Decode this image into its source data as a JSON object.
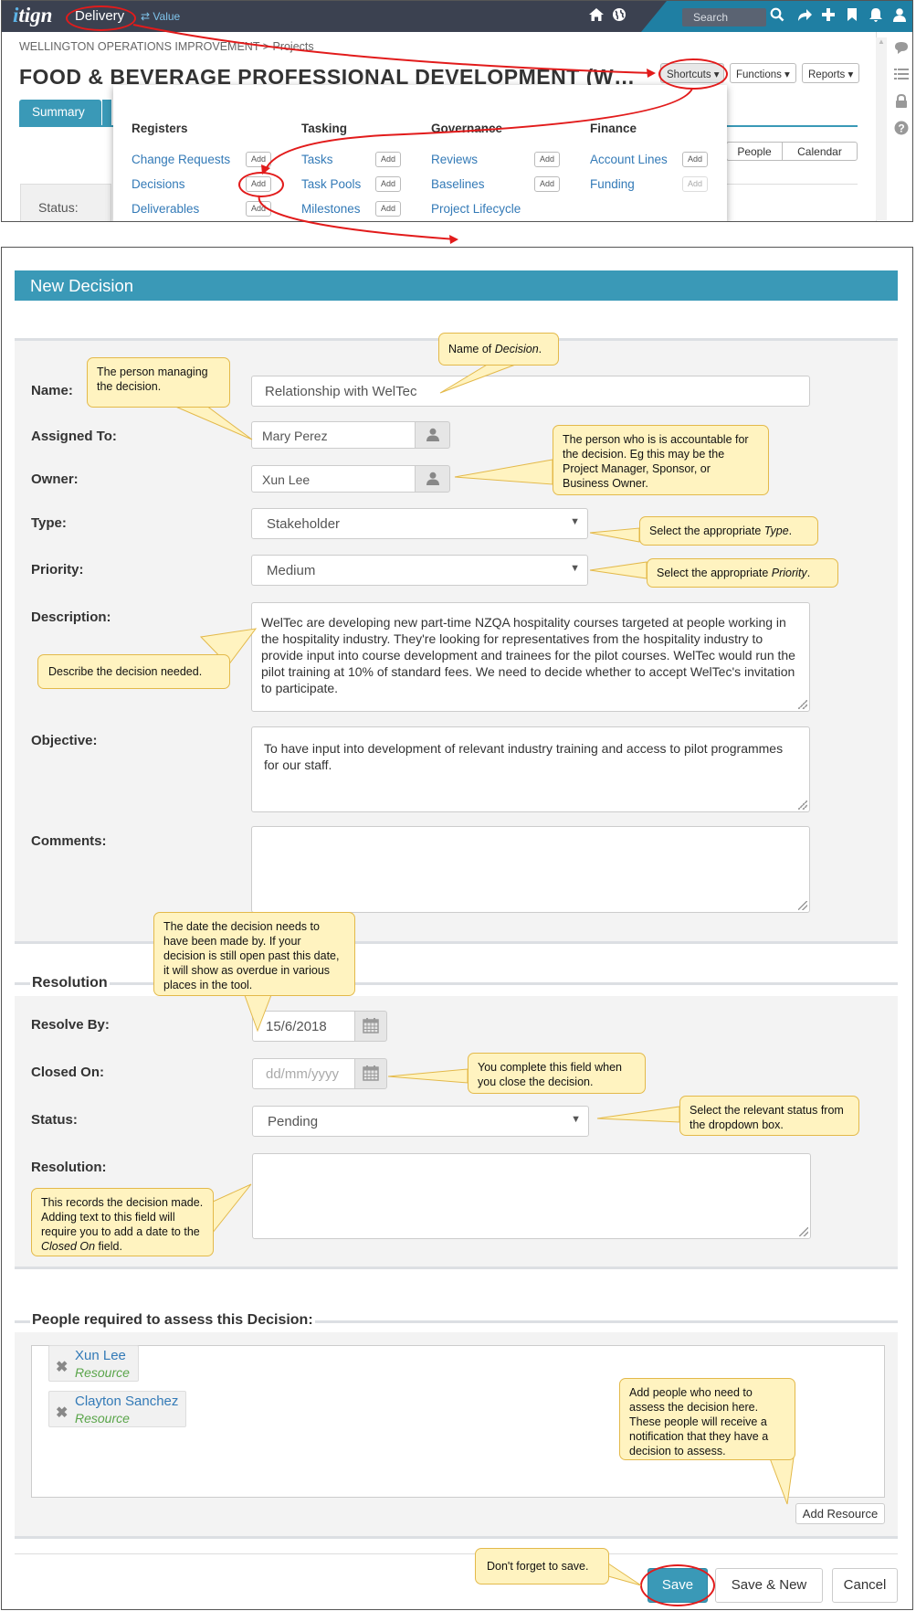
{
  "app": {
    "logo_prefix": "i",
    "logo_rest": "tign"
  },
  "nav": {
    "delivery": "Delivery",
    "value_arrow": "⇄",
    "value": "Value",
    "search_placeholder": "Search"
  },
  "breadcrumb": {
    "org": "WELLINGTON OPERATIONS IMPROVEMENT",
    "sep": " > ",
    "projects": "Projects"
  },
  "project_title": "FOOD & BEVERAGE PROFESSIONAL DEVELOPMENT (W…",
  "toolbar": {
    "shortcuts": "Shortcuts ▾",
    "functions": "Functions ▾",
    "reports": "Reports ▾"
  },
  "tabs": {
    "summary": "Summary"
  },
  "view_buttons": {
    "people": "People",
    "calendar": "Calendar"
  },
  "status_label": "Status:",
  "dropdown": {
    "add_label": "Add",
    "registers": {
      "heading": "Registers",
      "items": [
        "Change Requests",
        "Decisions",
        "Deliverables"
      ]
    },
    "tasking": {
      "heading": "Tasking",
      "items": [
        "Tasks",
        "Task Pools",
        "Milestones"
      ]
    },
    "governance": {
      "heading": "Governance",
      "items": [
        "Reviews",
        "Baselines",
        "Project Lifecycle"
      ]
    },
    "finance": {
      "heading": "Finance",
      "items": [
        "Account Lines",
        "Funding"
      ]
    }
  },
  "form": {
    "title": "New Decision",
    "name_label": "Name:",
    "name_value": "Relationship with WelTec",
    "assigned_label": "Assigned To:",
    "assigned_value": "Mary Perez",
    "owner_label": "Owner:",
    "owner_value": "Xun Lee",
    "type_label": "Type:",
    "type_value": "Stakeholder",
    "priority_label": "Priority:",
    "priority_value": "Medium",
    "description_label": "Description:",
    "description_value": "WelTec are developing new part-time NZQA hospitality courses targeted at people working in the hospitality industry.  They're looking for representatives from the hospitality industry to provide input into course development and trainees for the pilot courses. WelTec would run the pilot training at 10% of standard fees. We need to decide whether to accept WelTec's invitation to participate.",
    "objective_label": "Objective:",
    "objective_value": "To have input into development of relevant industry training and access to pilot programmes for our staff.",
    "comments_label": "Comments:",
    "resolution_legend": "Resolution",
    "resolve_by_label": "Resolve By:",
    "resolve_by_value": "15/6/2018",
    "closed_on_label": "Closed On:",
    "closed_on_placeholder": "dd/mm/yyyy",
    "status_label": "Status:",
    "status_value": "Pending",
    "resolution_label": "Resolution:",
    "people_legend": "People required to assess this Decision:",
    "people": [
      {
        "name": "Xun Lee",
        "role": "Resource"
      },
      {
        "name": "Clayton Sanchez",
        "role": "Resource"
      }
    ],
    "add_resource": "Add Resource",
    "save": "Save",
    "save_new": "Save & New",
    "cancel": "Cancel"
  },
  "callouts": {
    "name_of_pre": "Name of ",
    "name_of_em": "Decision",
    "name_of_post": ".",
    "person_managing": "The person managing the decision.",
    "accountable": "The person who is is accountable for the decision. Eg this may be the Project Manager, Sponsor, or Business Owner.",
    "type_pre": "Select the appropriate ",
    "type_em": "Type",
    "type_post": ".",
    "priority_pre": "Select the appropriate ",
    "priority_em": "Priority",
    "priority_post": ".",
    "describe": "Describe the decision needed.",
    "date_needed": "The date the decision needs to have been made by. If your decision is still open past this date, it will show as overdue in various places in the tool.",
    "closed": "You complete this field when you close the decision.",
    "status": "Select the relevant status from the dropdown box.",
    "records_pre": "This records the decision made.  Adding text to this field will require you to add a date to the ",
    "records_em": "Closed On",
    "records_post": " field.",
    "add_people": "Add people who need to assess the decision here. These people will receive a notification that they have a decision to assess.",
    "save": "Don't forget to save."
  }
}
